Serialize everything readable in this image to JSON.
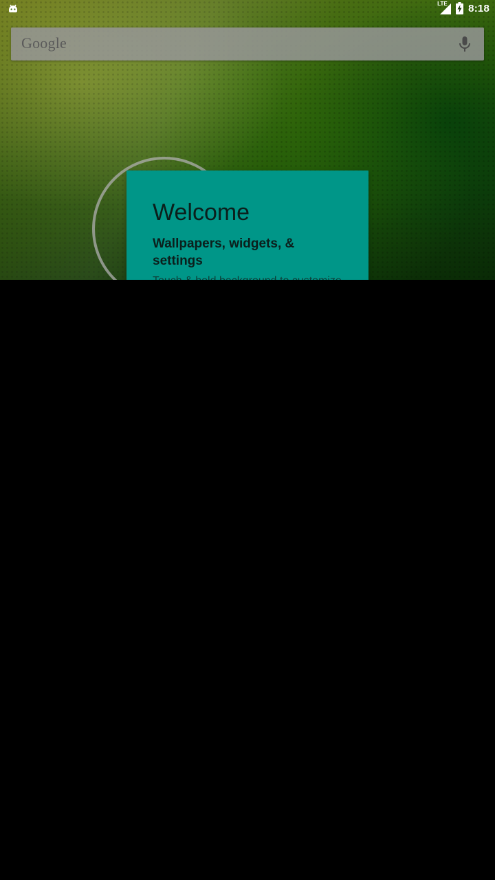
{
  "status_bar": {
    "time": "8:18",
    "network_label": "LTE",
    "icons": [
      "android-notification-icon",
      "lte-signal-icon",
      "battery-charging-icon"
    ]
  },
  "search": {
    "logo_text": "Google",
    "mic_icon": "mic-icon"
  },
  "welcome": {
    "title": "Welcome",
    "subtitle": "Wallpapers, widgets, & settings",
    "body": "Touch & hold background to customize"
  },
  "colors": {
    "card_background": "#009688",
    "search_background": "#969696",
    "ring": "#afafaf",
    "screen_background": "#000000"
  }
}
